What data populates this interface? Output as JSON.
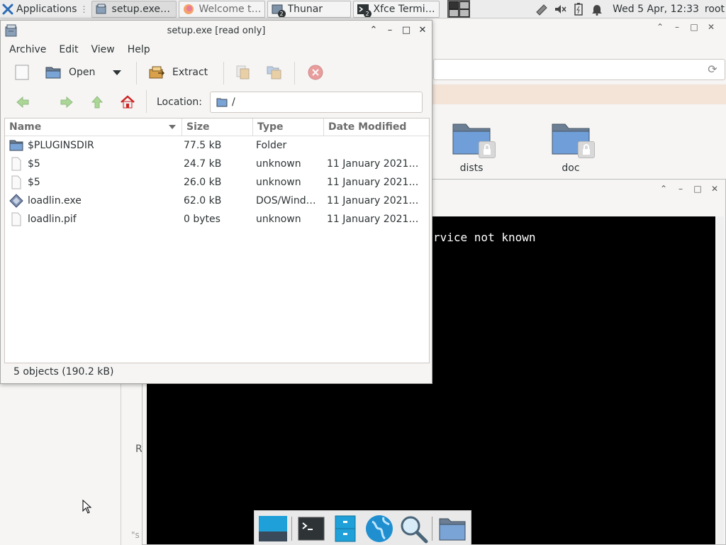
{
  "top_panel": {
    "applications_label": "Applications",
    "tasks": [
      {
        "label": "setup.exe [r...",
        "icon": "archive-icon",
        "active": true
      },
      {
        "label": "Welcome to...",
        "icon": "firefox-icon",
        "active": false
      },
      {
        "label": "Thunar",
        "icon": "file-manager-icon",
        "badge": "2",
        "active": false
      },
      {
        "label": "Xfce Terminal",
        "icon": "terminal-icon",
        "badge": "2",
        "active": false
      }
    ],
    "clock": "Wed  5 Apr, 12:33",
    "user": "root"
  },
  "thunar": {
    "folders": [
      {
        "name": "dists"
      },
      {
        "name": "doc"
      }
    ],
    "left_pane_letter": "R",
    "left_pane_fragment": "\"s"
  },
  "terminal": {
    "visible_line": "rvice not known"
  },
  "archive": {
    "title": "setup.exe [read only]",
    "menu": [
      "Archive",
      "Edit",
      "View",
      "Help"
    ],
    "toolbar": {
      "open_label": "Open",
      "extract_label": "Extract"
    },
    "location_label": "Location:",
    "location_value": "/",
    "columns": [
      "Name",
      "Size",
      "Type",
      "Date Modified"
    ],
    "files": [
      {
        "name": "$PLUGINSDIR",
        "size": "77.5 kB",
        "type": "Folder",
        "date": "",
        "icon": "folder-icon"
      },
      {
        "name": "$5",
        "size": "24.7 kB",
        "type": "unknown",
        "date": "11 January 2021, 0...",
        "icon": "file-icon"
      },
      {
        "name": "$5",
        "size": "26.0 kB",
        "type": "unknown",
        "date": "11 January 2021, 0...",
        "icon": "file-icon"
      },
      {
        "name": "loadlin.exe",
        "size": "62.0 kB",
        "type": "DOS/Windo...",
        "date": "11 January 2021, 0...",
        "icon": "executable-icon"
      },
      {
        "name": "loadlin.pif",
        "size": "0 bytes",
        "type": "unknown",
        "date": "11 January 2021, 0...",
        "icon": "file-icon"
      }
    ],
    "status": "5 objects (190.2 kB)"
  },
  "dock": {
    "items": [
      "desktop-icon",
      "terminal-icon",
      "file-cabinet-icon",
      "web-browser-icon",
      "search-icon",
      "folder-icon"
    ]
  }
}
